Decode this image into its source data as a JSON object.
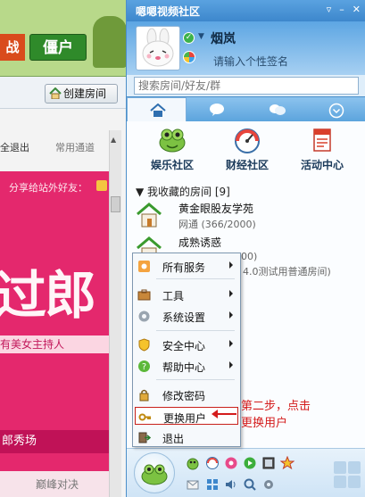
{
  "background_window": {
    "banner_red_text": "战",
    "banner_green_text": "僵户",
    "create_room_label": "创建房间",
    "tab_exit_label": "全退出",
    "tab_common_label": "常用通道",
    "share_text": "分享给站外好友：",
    "promo_big_text": "过郎",
    "promo_sub_text": "有美女主持人",
    "showroom_text": "郎秀场",
    "bottom_text": "巅峰对决"
  },
  "client": {
    "title": "嗯嗯视频社区",
    "nickname": "烟岚",
    "signature_placeholder": "请输入个性签名",
    "search_placeholder": "搜索房间/好友/群",
    "window_buttons": [
      "▿",
      "–",
      "✕"
    ],
    "nav_tabs": [
      "home-tab",
      "chat-tab",
      "friends-tab",
      "more-tab"
    ],
    "communities": [
      {
        "label": "娱乐社区",
        "icon": "frog-icon"
      },
      {
        "label": "财经社区",
        "icon": "gauge-icon"
      },
      {
        "label": "活动中心",
        "icon": "calendar-icon"
      }
    ],
    "room_section_header": "▼ 我收藏的房间 [9]",
    "rooms": [
      {
        "name": "黄金眼股友学苑",
        "count": "网通 (366/2000)"
      },
      {
        "name": "成熟诱惑",
        "count": "00)"
      },
      {
        "name": "",
        "count": "4.0测试用普通房间)"
      }
    ]
  },
  "context_menu": {
    "items": [
      {
        "label": "所有服务",
        "submenu": true,
        "icon": "services-icon"
      },
      {
        "label": "工具",
        "submenu": true,
        "icon": "toolbox-icon"
      },
      {
        "label": "系统设置",
        "submenu": true,
        "icon": "settings-icon"
      },
      {
        "label": "安全中心",
        "submenu": true,
        "icon": "shield-icon"
      },
      {
        "label": "帮助中心",
        "submenu": true,
        "icon": "help-icon"
      },
      {
        "label": "修改密码",
        "submenu": false,
        "icon": "lock-icon"
      },
      {
        "label": "更换用户",
        "submenu": false,
        "icon": "key-icon",
        "highlighted": true
      },
      {
        "label": "退出",
        "submenu": false,
        "icon": "exit-icon"
      }
    ]
  },
  "annotation": {
    "line1": "第二步，点击",
    "line2": "更换用户"
  },
  "colors": {
    "accent_blue": "#3d87cc",
    "highlight_red": "#c8201a",
    "annotation_red": "#d41c1c",
    "promo_pink": "#e4286d"
  }
}
